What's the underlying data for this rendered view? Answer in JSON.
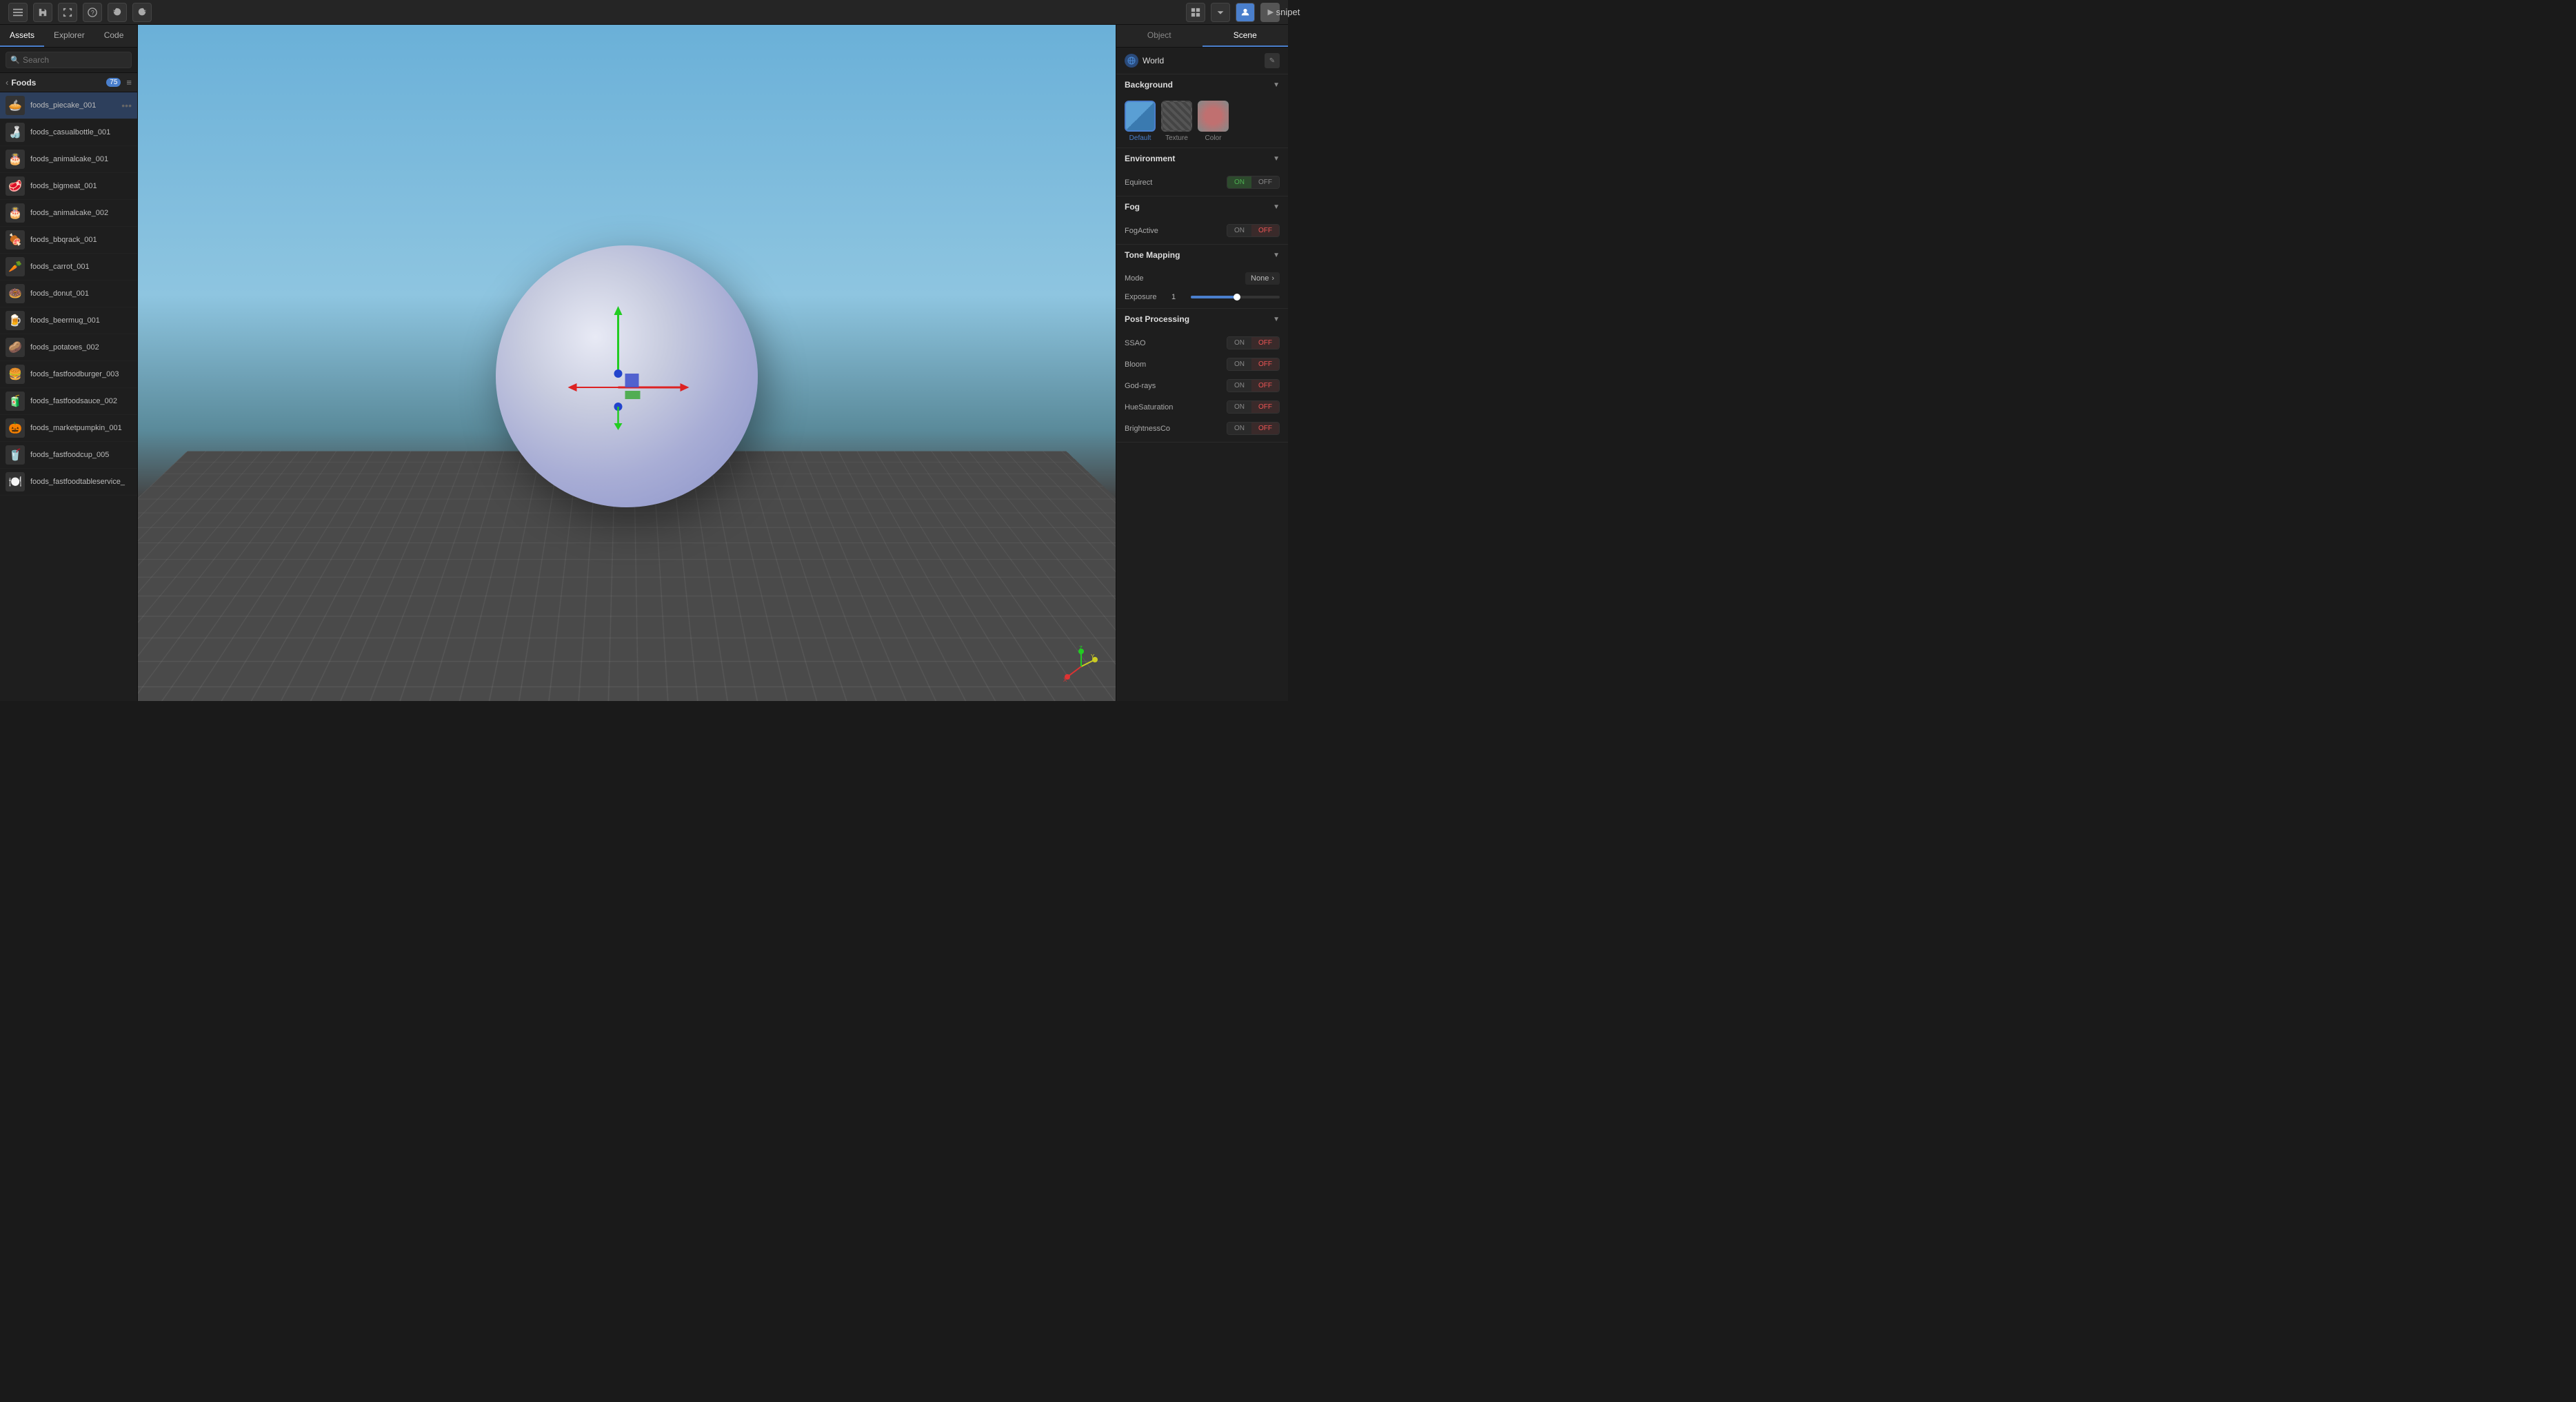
{
  "topbar": {
    "title": "snipet",
    "undo_label": "⟵",
    "redo_label": "⟶"
  },
  "sidebar": {
    "tabs": [
      {
        "label": "Assets",
        "active": true
      },
      {
        "label": "Explorer",
        "active": false
      },
      {
        "label": "Code",
        "active": false
      }
    ],
    "search_placeholder": "Search",
    "folder": {
      "name": "Foods",
      "count": "75"
    },
    "assets": [
      {
        "name": "foods_piecake_001",
        "emoji": "🥧",
        "selected": true
      },
      {
        "name": "foods_casualbottle_001",
        "emoji": "🍶"
      },
      {
        "name": "foods_animalcake_001",
        "emoji": "🎂"
      },
      {
        "name": "foods_bigmeat_001",
        "emoji": "🥩"
      },
      {
        "name": "foods_animalcake_002",
        "emoji": "🎂"
      },
      {
        "name": "foods_bbqrack_001",
        "emoji": "🍖"
      },
      {
        "name": "foods_carrot_001",
        "emoji": "🥕"
      },
      {
        "name": "foods_donut_001",
        "emoji": "🍩"
      },
      {
        "name": "foods_beermug_001",
        "emoji": "🍺"
      },
      {
        "name": "foods_potatoes_002",
        "emoji": "🥔"
      },
      {
        "name": "foods_fastfoodburger_003",
        "emoji": "🍔"
      },
      {
        "name": "foods_fastfoodsauce_002",
        "emoji": "🧃"
      },
      {
        "name": "foods_marketpumpkin_001",
        "emoji": "🎃"
      },
      {
        "name": "foods_fastfoodcup_005",
        "emoji": "🥤"
      },
      {
        "name": "foods_fastfoodtableservice_",
        "emoji": "🍽️"
      }
    ]
  },
  "right_panel": {
    "tabs": [
      {
        "label": "Object",
        "active": false
      },
      {
        "label": "Scene",
        "active": true
      }
    ],
    "world": {
      "label": "World"
    },
    "background": {
      "label": "Background",
      "options": [
        {
          "label": "Default",
          "selected": true
        },
        {
          "label": "Texture",
          "selected": false
        },
        {
          "label": "Color",
          "selected": false
        }
      ]
    },
    "environment": {
      "label": "Environment",
      "equirect": {
        "label": "Equirect",
        "on": true,
        "off": false
      }
    },
    "fog": {
      "label": "Fog",
      "fog_active": {
        "label": "FogActive",
        "on": false,
        "off": true
      }
    },
    "tone_mapping": {
      "label": "Tone Mapping",
      "mode": {
        "label": "Mode",
        "value": "None"
      },
      "exposure": {
        "label": "Exposure",
        "value": "1"
      }
    },
    "post_processing": {
      "label": "Post Processing",
      "ssao": {
        "label": "SSAO",
        "on": false,
        "off": true
      },
      "bloom": {
        "label": "Bloom",
        "on": false,
        "off": true
      },
      "god_rays": {
        "label": "God-rays",
        "on": false,
        "off": true
      },
      "hue_saturation": {
        "label": "HueSaturation",
        "on": false,
        "off": true
      },
      "brightness_contrast": {
        "label": "BrightnessCo",
        "on": false,
        "off": true
      }
    }
  }
}
